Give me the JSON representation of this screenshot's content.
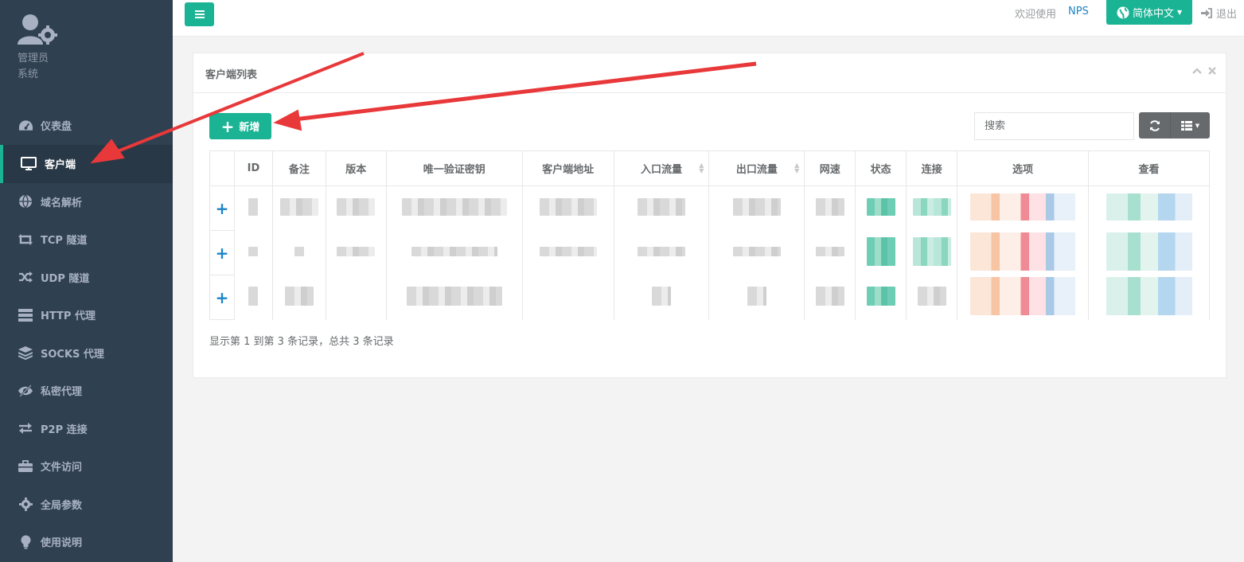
{
  "profile": {
    "role": "管理员",
    "sub": "系统"
  },
  "sidebar": {
    "items": [
      {
        "label": "仪表盘",
        "icon": "dashboard-icon"
      },
      {
        "label": "客户端",
        "icon": "monitor-icon",
        "active": true
      },
      {
        "label": "域名解析",
        "icon": "globe-icon"
      },
      {
        "label": "TCP 隧道",
        "icon": "retweet-icon"
      },
      {
        "label": "UDP 隧道",
        "icon": "random-icon"
      },
      {
        "label": "HTTP 代理",
        "icon": "server-icon"
      },
      {
        "label": "SOCKS 代理",
        "icon": "layers-icon"
      },
      {
        "label": "私密代理",
        "icon": "eye-slash-icon"
      },
      {
        "label": "P2P 连接",
        "icon": "exchange-icon"
      },
      {
        "label": "文件访问",
        "icon": "briefcase-icon"
      },
      {
        "label": "全局参数",
        "icon": "gear-icon"
      },
      {
        "label": "使用说明",
        "icon": "lightbulb-icon"
      }
    ]
  },
  "topbar": {
    "welcome": "欢迎使用",
    "brand": "NPS",
    "language": "简体中文",
    "logout": "退出"
  },
  "panel": {
    "title": "客户端列表",
    "add_label": "新增",
    "search_placeholder": "搜索",
    "columns": [
      "",
      "ID",
      "备注",
      "版本",
      "唯一验证密钥",
      "客户端地址",
      "入口流量",
      "出口流量",
      "网速",
      "状态",
      "连接",
      "选项",
      "查看"
    ],
    "rows_count": 3,
    "footer": "显示第 1 到第 3 条记录，总共 3 条记录"
  },
  "colors": {
    "accent": "#1ab394",
    "sidebar": "#2f4050",
    "link": "#1c84c6",
    "annotation_arrow": "#e8383a"
  }
}
